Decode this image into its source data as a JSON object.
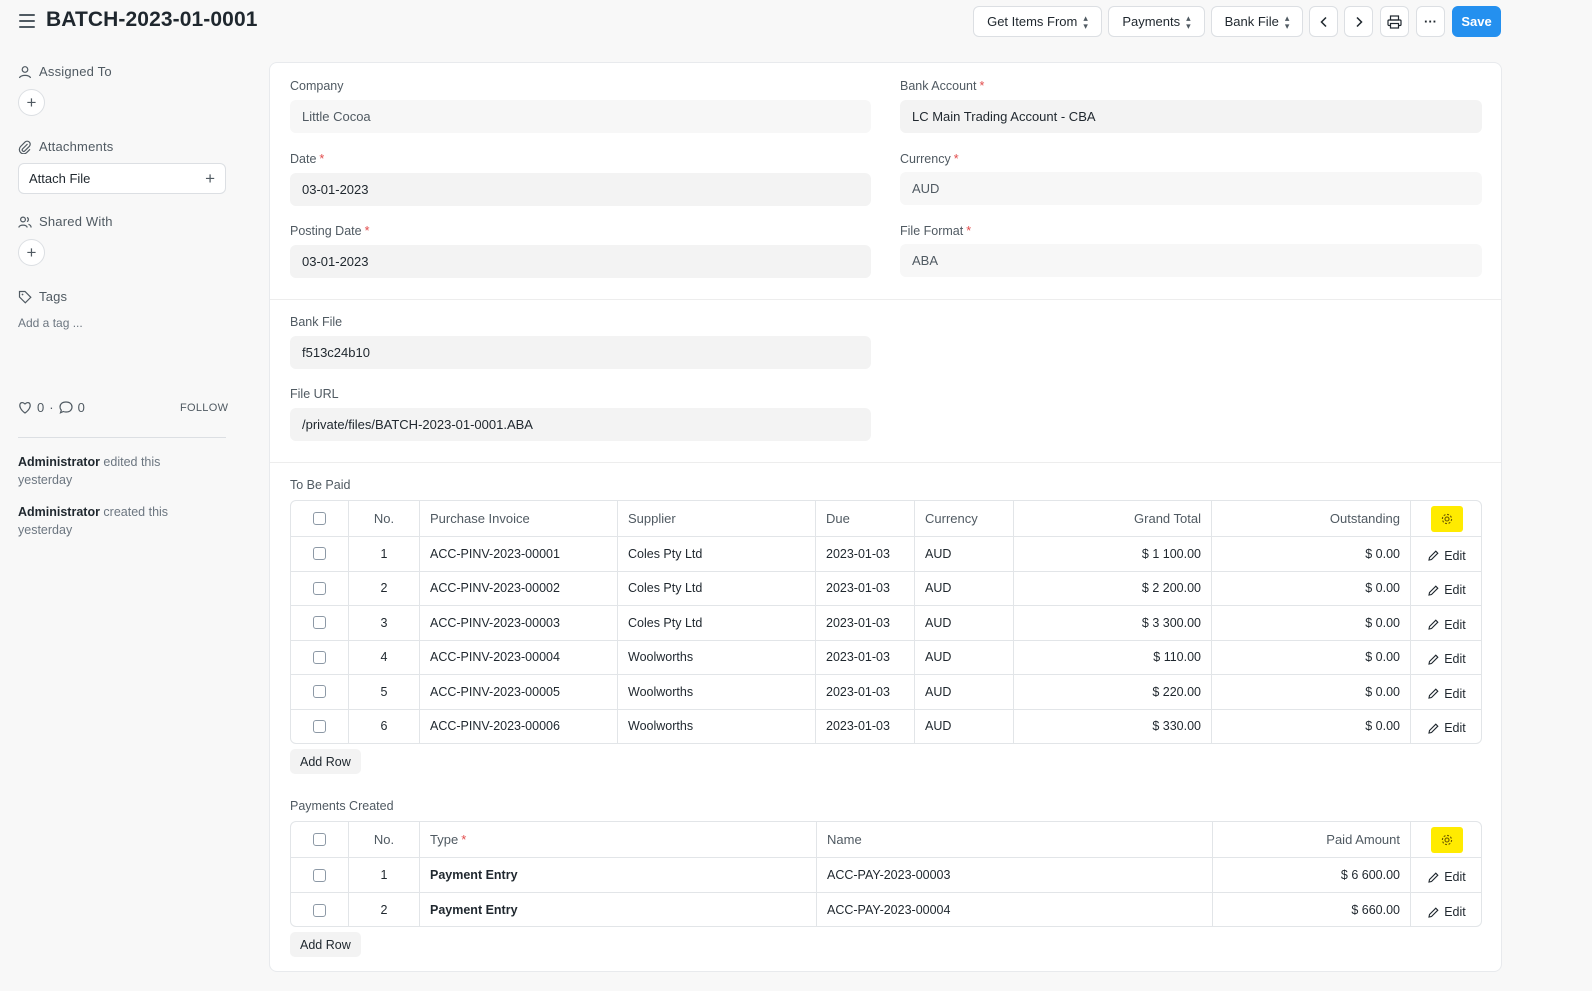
{
  "header": {
    "title": "BATCH-2023-01-0001",
    "get_items_from": "Get Items From",
    "payments": "Payments",
    "bank_file": "Bank File",
    "save": "Save"
  },
  "sidebar": {
    "assigned_to": "Assigned To",
    "attachments": "Attachments",
    "attach_file": "Attach File",
    "shared_with": "Shared With",
    "tags": "Tags",
    "add_tag": "Add a tag ...",
    "likes": "0",
    "comments": "0",
    "follow": "FOLLOW",
    "timeline": [
      {
        "user": "Administrator",
        "action": " edited this yesterday"
      },
      {
        "user": "Administrator",
        "action": " created this yesterday"
      }
    ]
  },
  "form": {
    "company_label": "Company",
    "company": "Little Cocoa",
    "bank_account_label": "Bank Account",
    "bank_account": "LC Main Trading Account - CBA",
    "date_label": "Date",
    "date": "03-01-2023",
    "currency_label": "Currency",
    "currency": "AUD",
    "posting_date_label": "Posting Date",
    "posting_date": "03-01-2023",
    "file_format_label": "File Format",
    "file_format": "ABA",
    "bank_file_label": "Bank File",
    "bank_file": "f513c24b10",
    "file_url_label": "File URL",
    "file_url": "/private/files/BATCH-2023-01-0001.ABA"
  },
  "to_be_paid": {
    "title": "To Be Paid",
    "headers": {
      "no": "No.",
      "invoice": "Purchase Invoice",
      "supplier": "Supplier",
      "due": "Due",
      "currency": "Currency",
      "grand_total": "Grand Total",
      "outstanding": "Outstanding"
    },
    "edit_label": "Edit",
    "add_row": "Add Row",
    "rows": [
      {
        "no": "1",
        "invoice": "ACC-PINV-2023-00001",
        "supplier": "Coles Pty Ltd",
        "due": "2023-01-03",
        "currency": "AUD",
        "grand_total": "$ 1 100.00",
        "outstanding": "$ 0.00"
      },
      {
        "no": "2",
        "invoice": "ACC-PINV-2023-00002",
        "supplier": "Coles Pty Ltd",
        "due": "2023-01-03",
        "currency": "AUD",
        "grand_total": "$ 2 200.00",
        "outstanding": "$ 0.00"
      },
      {
        "no": "3",
        "invoice": "ACC-PINV-2023-00003",
        "supplier": "Coles Pty Ltd",
        "due": "2023-01-03",
        "currency": "AUD",
        "grand_total": "$ 3 300.00",
        "outstanding": "$ 0.00"
      },
      {
        "no": "4",
        "invoice": "ACC-PINV-2023-00004",
        "supplier": "Woolworths",
        "due": "2023-01-03",
        "currency": "AUD",
        "grand_total": "$ 110.00",
        "outstanding": "$ 0.00"
      },
      {
        "no": "5",
        "invoice": "ACC-PINV-2023-00005",
        "supplier": "Woolworths",
        "due": "2023-01-03",
        "currency": "AUD",
        "grand_total": "$ 220.00",
        "outstanding": "$ 0.00"
      },
      {
        "no": "6",
        "invoice": "ACC-PINV-2023-00006",
        "supplier": "Woolworths",
        "due": "2023-01-03",
        "currency": "AUD",
        "grand_total": "$ 330.00",
        "outstanding": "$ 0.00"
      }
    ]
  },
  "payments_created": {
    "title": "Payments Created",
    "headers": {
      "no": "No.",
      "type": "Type",
      "name": "Name",
      "paid_amount": "Paid Amount"
    },
    "edit_label": "Edit",
    "add_row": "Add Row",
    "rows": [
      {
        "no": "1",
        "type": "Payment Entry",
        "name": "ACC-PAY-2023-00003",
        "paid_amount": "$ 6 600.00"
      },
      {
        "no": "2",
        "type": "Payment Entry",
        "name": "ACC-PAY-2023-00004",
        "paid_amount": "$ 660.00"
      }
    ]
  },
  "colors": {
    "primary": "#2490ef",
    "highlight": "#ffeb00",
    "required": "#e24c4c"
  }
}
